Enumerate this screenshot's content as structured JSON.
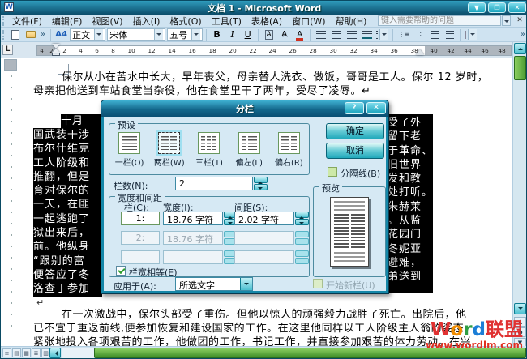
{
  "window": {
    "icon_label": "W",
    "title": "文档 1 - Microsoft Word",
    "minimize_glyph": "▼",
    "restore_glyph": "❐",
    "close_glyph": "✕"
  },
  "menu": {
    "items": [
      "文件(F)",
      "编辑(E)",
      "视图(V)",
      "插入(I)",
      "格式(O)",
      "工具(T)",
      "表格(A)",
      "窗口(W)",
      "帮助(H)"
    ],
    "help_box": "键入需要帮助的问题",
    "close_glyph": "✕"
  },
  "toolbar": {
    "overflow_glyph": "»",
    "styles_icon_label": "A4",
    "style_value": "正文",
    "font_value": "宋体",
    "size_value": "五号",
    "bold": "B",
    "italic": "I",
    "underline": "U",
    "char_border": "A",
    "char_shading": "A",
    "font_color": "A",
    "numbering_glyph": "⋮≡",
    "bullets_glyph": "∷"
  },
  "ruler": {
    "tab_selector": "L",
    "left_numbers": [
      "4",
      "2"
    ],
    "center_numbers": [
      "2",
      "4",
      "6",
      "8",
      "10",
      "12",
      "14",
      "16",
      "18",
      "20",
      "22",
      "24",
      "26",
      "28",
      "30",
      "32",
      "34",
      "36",
      "38"
    ],
    "right_numbers": [
      "40",
      "42",
      "44",
      "46",
      "48"
    ]
  },
  "document": {
    "para1_line1": "保尔从小在苦水中长大，早年丧父，母亲替人洗衣、做饭，哥哥是工人。保尔 12 岁时，",
    "para1_line2": "母亲把他送到车站食堂当杂役，他在食堂里干了两年，受尽了凌辱。↵",
    "selected_left": [
      "十月",
      "国武装干涉",
      "布尔什维克",
      "工人阶级和",
      "推翻，但是",
      "育对保尔的",
      "一天，在匪",
      "一起逃跑了",
      "狱出来后，",
      "前。他纵身",
      "“跟别的富",
      "便答应了冬",
      "洛查丁参加"
    ],
    "selected_right": [
      "受了外",
      "留下老",
      "于革命、",
      "旧世界",
      "发和教",
      "处打听。",
      "朱赫莱",
      "。从监",
      "花园门",
      "冬妮亚",
      "避难，",
      "弟送到"
    ],
    "pilcrow": "↵",
    "para2_line1": "在一次激战中，保尔头部受了重伤。但他以惊人的顽强毅力战胜了死亡。出院后，他",
    "para2_line2": "已不宜于重返前线,便参加恢复和建设国家的工作。在这里他同样以工人阶级主人翁的姿态，",
    "para2_line3": "紧张地投入各项艰苦的工作，他做团的工作，书记工作，并直接参加艰苦的体力劳动。在兴",
    "watermark": {
      "w": "W",
      "o": "o",
      "r": "r",
      "d": "d",
      "suffix": "联盟",
      "url": "www.wordlm.com"
    }
  },
  "dialog": {
    "title": "分栏",
    "help_glyph": "?",
    "close_glyph": "✕",
    "presets_label": "预设",
    "presets": [
      {
        "label": "一栏(O)"
      },
      {
        "label": "两栏(W)"
      },
      {
        "label": "三栏(T)"
      },
      {
        "label": "偏左(L)"
      },
      {
        "label": "偏右(R)"
      }
    ],
    "ok_label": "确定",
    "cancel_label": "取消",
    "line_between_label": "分隔线(B)",
    "columns_label": "栏数(N):",
    "columns_value": "2",
    "width_group_label": "宽度和间距",
    "col_header": "栏(C):",
    "width_header": "宽度(I):",
    "spacing_header": "间距(S):",
    "rows": [
      {
        "col": "1:",
        "width": "18.76 字符",
        "spacing": "2.02 字符"
      },
      {
        "col": "2:",
        "width": "18.76 字符",
        "spacing": ""
      },
      {
        "col": "",
        "width": "",
        "spacing": ""
      }
    ],
    "equal_width_label": "栏宽相等(E)",
    "apply_label": "应用于(A):",
    "apply_value": "所选文字",
    "preview_label": "预览",
    "start_new_label": "开始新栏(U)"
  },
  "statusbar": {
    "view_glyphs": [
      "≡",
      "▤",
      "▦",
      "≣",
      "▥"
    ]
  },
  "colors": {
    "titlebar_teal": "#0b4d6b",
    "button_teal": "#17a3bd",
    "selection_bg": "#000000",
    "scroll_thumb_green": "#4d9c33",
    "watermark_red": "#e03020"
  }
}
